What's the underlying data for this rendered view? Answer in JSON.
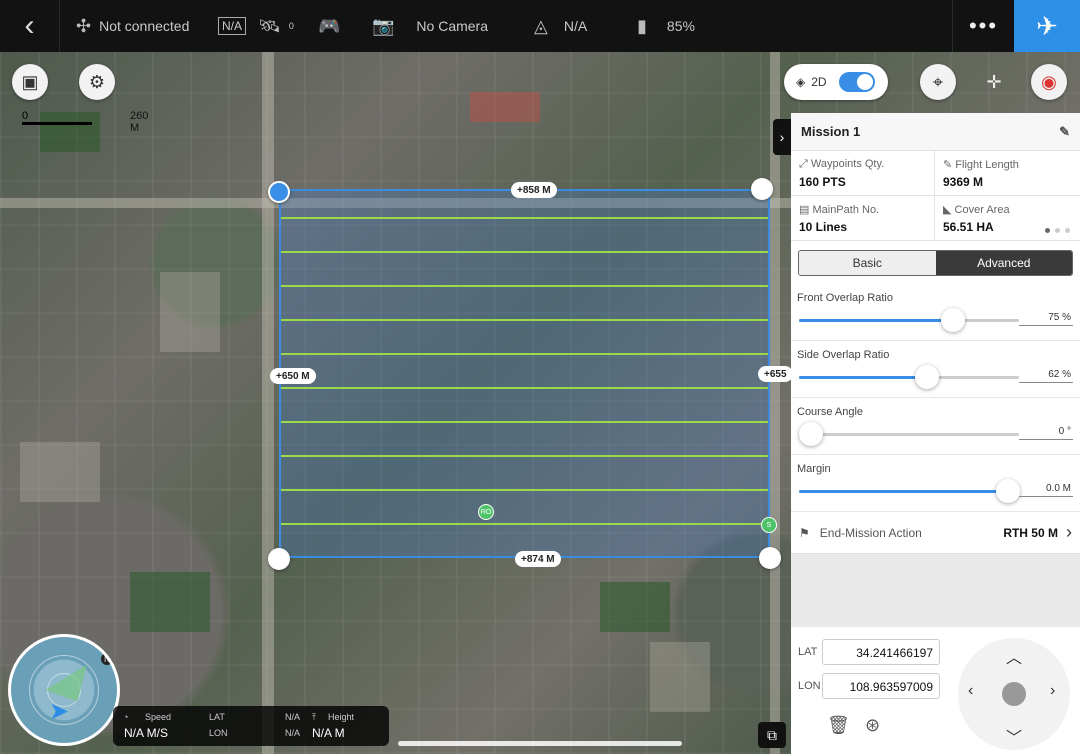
{
  "topbar": {
    "back_icon": "chevron-left-icon",
    "connection": "Not connected",
    "gps_na": "N/A",
    "satellite_count": "0",
    "camera": "No Camera",
    "signal": "N/A",
    "battery": "85%"
  },
  "map": {
    "toggle_label": "2D",
    "scale_start": "0",
    "scale_end": "260 M",
    "dims": {
      "top": "858 M",
      "bottom": "874 M",
      "left": "650 M",
      "right": "655"
    },
    "markers": {
      "ro": "RO",
      "s": "S"
    }
  },
  "panel": {
    "title": "Mission 1",
    "stats": [
      {
        "label": "Waypoints Qty.",
        "value": "160 PTS"
      },
      {
        "label": "Flight Length",
        "value": "9369 M"
      },
      {
        "label": "MainPath No.",
        "value": "10 Lines"
      },
      {
        "label": "Cover Area",
        "value": "56.51 HA"
      }
    ],
    "tabs": {
      "basic": "Basic",
      "advanced": "Advanced"
    },
    "sliders": [
      {
        "label": "Front Overlap Ratio",
        "value": "75 %",
        "fraction": 0.7
      },
      {
        "label": "Side Overlap Ratio",
        "value": "62 %",
        "fraction": 0.58
      },
      {
        "label": "Course Angle",
        "value": "0 °",
        "fraction": 0.0
      },
      {
        "label": "Margin",
        "value": "0.0 M",
        "fraction": 0.95
      }
    ],
    "end_mission": {
      "label": "End-Mission Action",
      "value": "RTH 50 M"
    },
    "lat_label": "LAT",
    "lat_value": "34.241466197",
    "lon_label": "LON",
    "lon_value": "108.963597009"
  },
  "hud": {
    "speed_label": "Speed",
    "speed_value": "N/A M/S",
    "gps_tag": "G\nP\nS",
    "lat_label": "LAT",
    "lon_label": "LON",
    "lat_value": "N/A",
    "lon_value": "N/A",
    "height_label": "Height",
    "height_value": "N/A M",
    "north": "N"
  },
  "colors": {
    "accent": "#3a8ee6",
    "fly_button": "#2d8fe6",
    "path": "#9bd94a"
  }
}
